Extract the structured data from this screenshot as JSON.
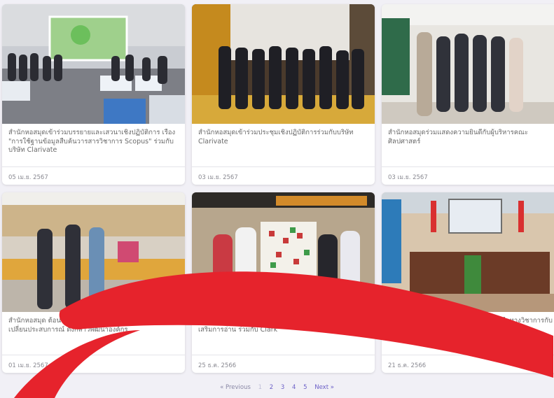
{
  "cards": [
    {
      "title": "สำนักหอสมุดเข้าร่วมบรรยายและเสวนาเชิงปฏิบัติการ เรื่อง \"การใช้ฐานข้อมูลสืบค้นวารสารวิชาการ Scopus\" ร่วมกับ บริษัท Clarivate",
      "date": "05 เม.ย. 2567"
    },
    {
      "title": "สำนักหอสมุดเข้าร่วมประชุมเชิงปฏิบัติการร่วมกับบริษัท Clarivate",
      "date": "03 เม.ย. 2567"
    },
    {
      "title": "สำนักหอสมุดร่วมแสดงความยินดีกับผู้บริหารคณะศิลปศาสตร์",
      "date": "03 เม.ย. 2567"
    },
    {
      "title": "สำนักหอสมุด ต้อนรับคณะศึกษาดูงาน ณ ห้องสมุด ร่วมแลกเปลี่ยนประสบการณ์ ดังกล่าวพัฒนาองค์กร",
      "date": "01 เม.ย. 2567"
    },
    {
      "title": "วันที่ 20–25 ธันวาคม 2566 สำนักหอสมุด จัดกิจกรรมส่งเสริมการอ่าน ร่วมกับ Clark",
      "date": "25 ธ.ค. 2566"
    },
    {
      "title": "สำนักหอสมุดร่วมประชุมหารือความร่วมมือทางวิชาการกับ Science and Technology",
      "date": "21 ธ.ค. 2566"
    }
  ],
  "pagination": {
    "previous": "« Previous",
    "pages": [
      "1",
      "2",
      "3",
      "4",
      "5"
    ],
    "current": "1",
    "next": "Next »"
  },
  "colors": {
    "swoosh": "#e6232c",
    "background": "#f1f0f6",
    "link": "#6b5fc7"
  }
}
